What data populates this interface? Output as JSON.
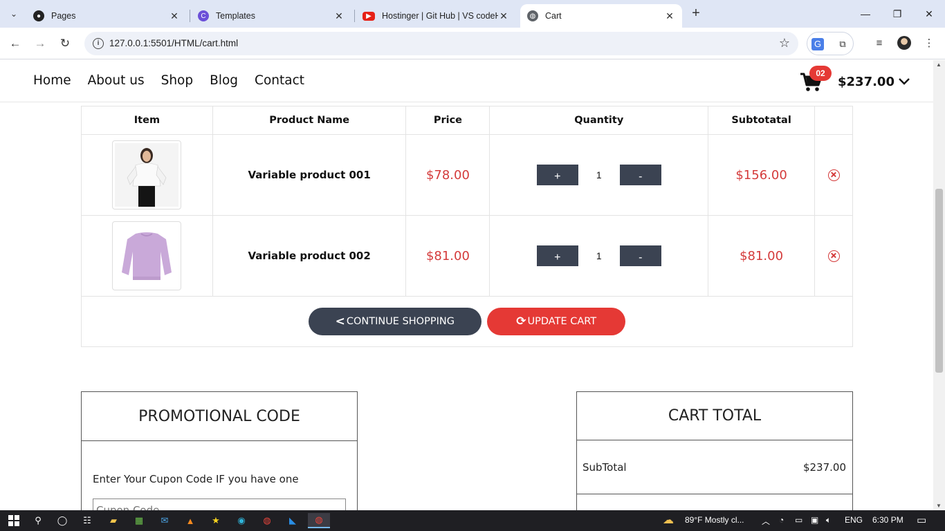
{
  "browser": {
    "tabs": [
      {
        "title": "Pages",
        "active": false
      },
      {
        "title": "Templates",
        "active": false
      },
      {
        "title": "Hostinger | Git Hub | VS codeH",
        "active": false
      },
      {
        "title": "Cart",
        "active": true
      }
    ],
    "url": "127.0.0.1:5501/HTML/cart.html"
  },
  "site": {
    "nav": [
      "Home",
      "About us",
      "Shop",
      "Blog",
      "Contact"
    ],
    "cart_count": "02",
    "cart_total": "$237.00"
  },
  "cart": {
    "headers": [
      "Item",
      "Product Name",
      "Price",
      "Quantity",
      "Subtotatal",
      ""
    ],
    "rows": [
      {
        "name": "Variable product 001",
        "price": "$78.00",
        "qty": "1",
        "subtotal": "$156.00",
        "image": "woman-white-blouse"
      },
      {
        "name": "Variable product 002",
        "price": "$81.00",
        "qty": "1",
        "subtotal": "$81.00",
        "image": "lilac-sweatshirt"
      }
    ],
    "plus_label": "+",
    "minus_label": "-",
    "continue_label": "CONTINUE SHOPPING",
    "update_label": "UPDATE CART"
  },
  "promo": {
    "title": "PROMOTIONAL CODE",
    "label": "Enter Your Cupon Code IF you have one",
    "placeholder": "Cupon Code"
  },
  "totals": {
    "title": "CART TOTAL",
    "subtotal_label": "SubTotal",
    "subtotal_value": "$237.00"
  },
  "taskbar": {
    "weather": "89°F  Mostly cl...",
    "lang": "ENG",
    "time": "6:30 PM"
  },
  "colors": {
    "accent_red": "#e53935",
    "dark_button": "#3b4352",
    "price_red": "#d43b3b"
  }
}
